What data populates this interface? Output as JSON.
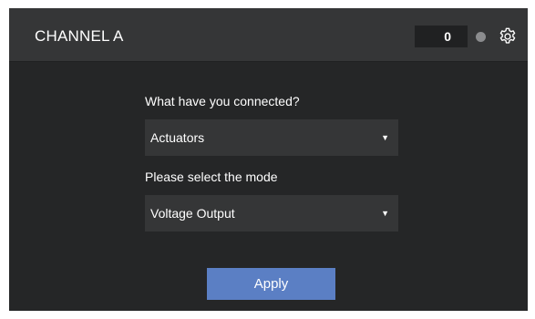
{
  "header": {
    "title": "CHANNEL A",
    "counter": "0",
    "settings_icon": "gear-icon"
  },
  "form": {
    "connected_label": "What have you connected?",
    "connected_value": "Actuators",
    "mode_label": "Please select the mode",
    "mode_value": "Voltage Output",
    "apply_label": "Apply",
    "dropdown_icon": "caret-down-icon"
  },
  "colors": {
    "panel_bg": "#252627",
    "header_bg": "#353637",
    "field_bg": "#353637",
    "accent": "#5b7fc4",
    "status_dot": "#8b8c8e"
  }
}
